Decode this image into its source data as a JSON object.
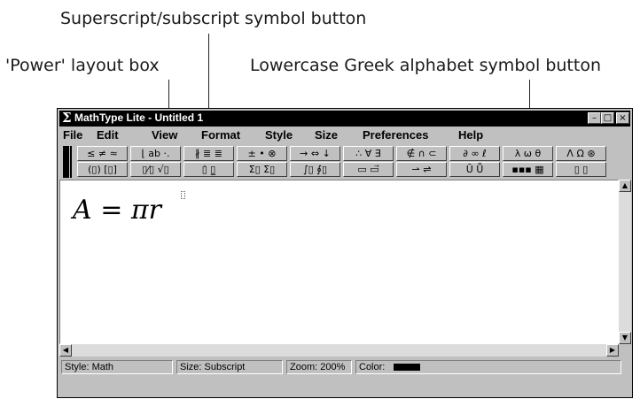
{
  "callouts": {
    "superscript": "Superscript/subscript symbol button",
    "power": "'Power' layout box",
    "greek": "Lowercase Greek alphabet symbol button"
  },
  "window": {
    "title": "MathType Lite - Untitled 1",
    "sigma": "Σ",
    "min": "–",
    "max": "□",
    "close": "×"
  },
  "menu": [
    "File",
    "Edit",
    "View",
    "Format",
    "Style",
    "Size",
    "Preferences",
    "Help"
  ],
  "toolbar": {
    "row1": [
      "≤ ≠ ≈",
      "⌊ ab ·.",
      "∦ ≣ ≣",
      "± • ⊗",
      "→ ⇔ ↓",
      "∴ ∀ ∃",
      "∉ ∩ ⊂",
      "∂ ∞ ℓ",
      "λ ω θ",
      "Λ Ω ⊛"
    ],
    "row2": [
      "(▯) [▯]",
      "▯⁄▯ √▯",
      "▯̇ ▯̲",
      "Σ▯ Σ▯",
      "∫▯ ∮▯",
      "▭ ▭⃗",
      "⇀ ⇌",
      "Ū Ṻ",
      "▪▪▪ ▦",
      "▯ ▯"
    ]
  },
  "document": {
    "formula": "A = πr"
  },
  "status": {
    "style": "Style: Math",
    "size": "Size: Subscript",
    "zoom": "Zoom: 200%",
    "color": "Color:",
    "color_value": "#000000"
  }
}
